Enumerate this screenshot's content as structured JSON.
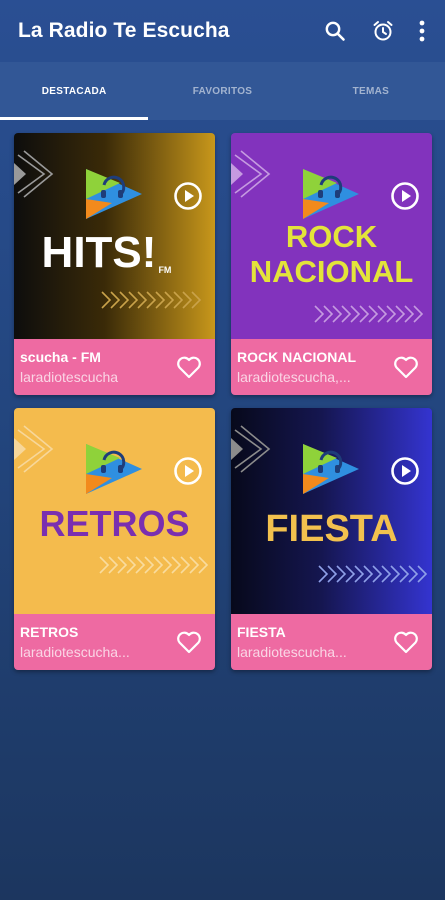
{
  "app": {
    "title": "La Radio Te Escucha"
  },
  "toolbar": {
    "icons": [
      "search-icon",
      "alarm-clock-icon",
      "more-vert-icon"
    ]
  },
  "tabs": [
    {
      "label": "DESTACADA",
      "active": true
    },
    {
      "label": "FAVORITOS",
      "active": false
    },
    {
      "label": "TEMAS",
      "active": false
    }
  ],
  "stations": [
    {
      "cover_line1": "HITS!",
      "cover_badge": "FM",
      "cover_line2": "",
      "name": "scucha - FM",
      "subtitle": "laradiotescucha",
      "colors": [
        "#111111",
        "#b88a15"
      ],
      "text_color": "#ffffff"
    },
    {
      "cover_line1": "ROCK",
      "cover_badge": "",
      "cover_line2": "NACIONAL",
      "name": "ROCK NACIONAL",
      "subtitle": "laradiotescucha,...",
      "colors": [
        "#7b2bb3",
        "#8c3dc4"
      ],
      "text_color": "#e3e43a"
    },
    {
      "cover_line1": "RETROS",
      "cover_badge": "",
      "cover_line2": "",
      "name": "RETROS",
      "subtitle": "laradiotescucha...",
      "colors": [
        "#f3b94a",
        "#f5be52"
      ],
      "text_color": "#7a2fb0"
    },
    {
      "cover_line1": "FIESTA",
      "cover_badge": "",
      "cover_line2": "",
      "name": "FIESTA",
      "subtitle": "laradiotescucha...",
      "colors": [
        "#0c0f26",
        "#3030c9"
      ],
      "text_color": "#f2c14e"
    }
  ],
  "colors": {
    "info_bar": "#ee6aa2",
    "tab_bar": "#325796",
    "background": "#2a4f93"
  }
}
